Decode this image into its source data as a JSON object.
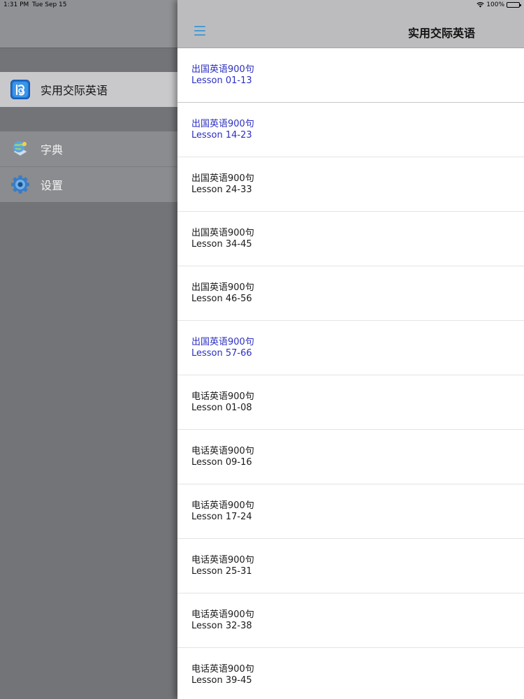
{
  "status_bar": {
    "time": "1:31 PM",
    "date": "Tue Sep 15",
    "battery": "100%"
  },
  "sidebar": {
    "active_item": {
      "label": "实用交际英语",
      "icon": "app-logo-icon"
    },
    "items": [
      {
        "label": "字典",
        "icon": "dictionary-icon"
      },
      {
        "label": "设置",
        "icon": "gear-icon"
      }
    ]
  },
  "nav": {
    "title": "实用交际英语",
    "menu_icon": "hamburger-menu-icon"
  },
  "colors": {
    "visited_link": "#2b2fc2",
    "accent": "#4a9ad0"
  },
  "lessons": [
    {
      "title": "出国英语900句",
      "range": "Lesson 01-13",
      "visited": true
    },
    {
      "title": "出国英语900句",
      "range": "Lesson 14-23",
      "visited": true
    },
    {
      "title": "出国英语900句",
      "range": "Lesson 24-33",
      "visited": false
    },
    {
      "title": "出国英语900句",
      "range": "Lesson 34-45",
      "visited": false
    },
    {
      "title": "出国英语900句",
      "range": "Lesson 46-56",
      "visited": false
    },
    {
      "title": "出国英语900句",
      "range": "Lesson 57-66",
      "visited": true
    },
    {
      "title": "电话英语900句",
      "range": "Lesson 01-08",
      "visited": false
    },
    {
      "title": "电话英语900句",
      "range": "Lesson 09-16",
      "visited": false
    },
    {
      "title": "电话英语900句",
      "range": "Lesson 17-24",
      "visited": false
    },
    {
      "title": "电话英语900句",
      "range": "Lesson 25-31",
      "visited": false
    },
    {
      "title": "电话英语900句",
      "range": "Lesson 32-38",
      "visited": false
    },
    {
      "title": "电话英语900句",
      "range": "Lesson 39-45",
      "visited": false
    }
  ]
}
